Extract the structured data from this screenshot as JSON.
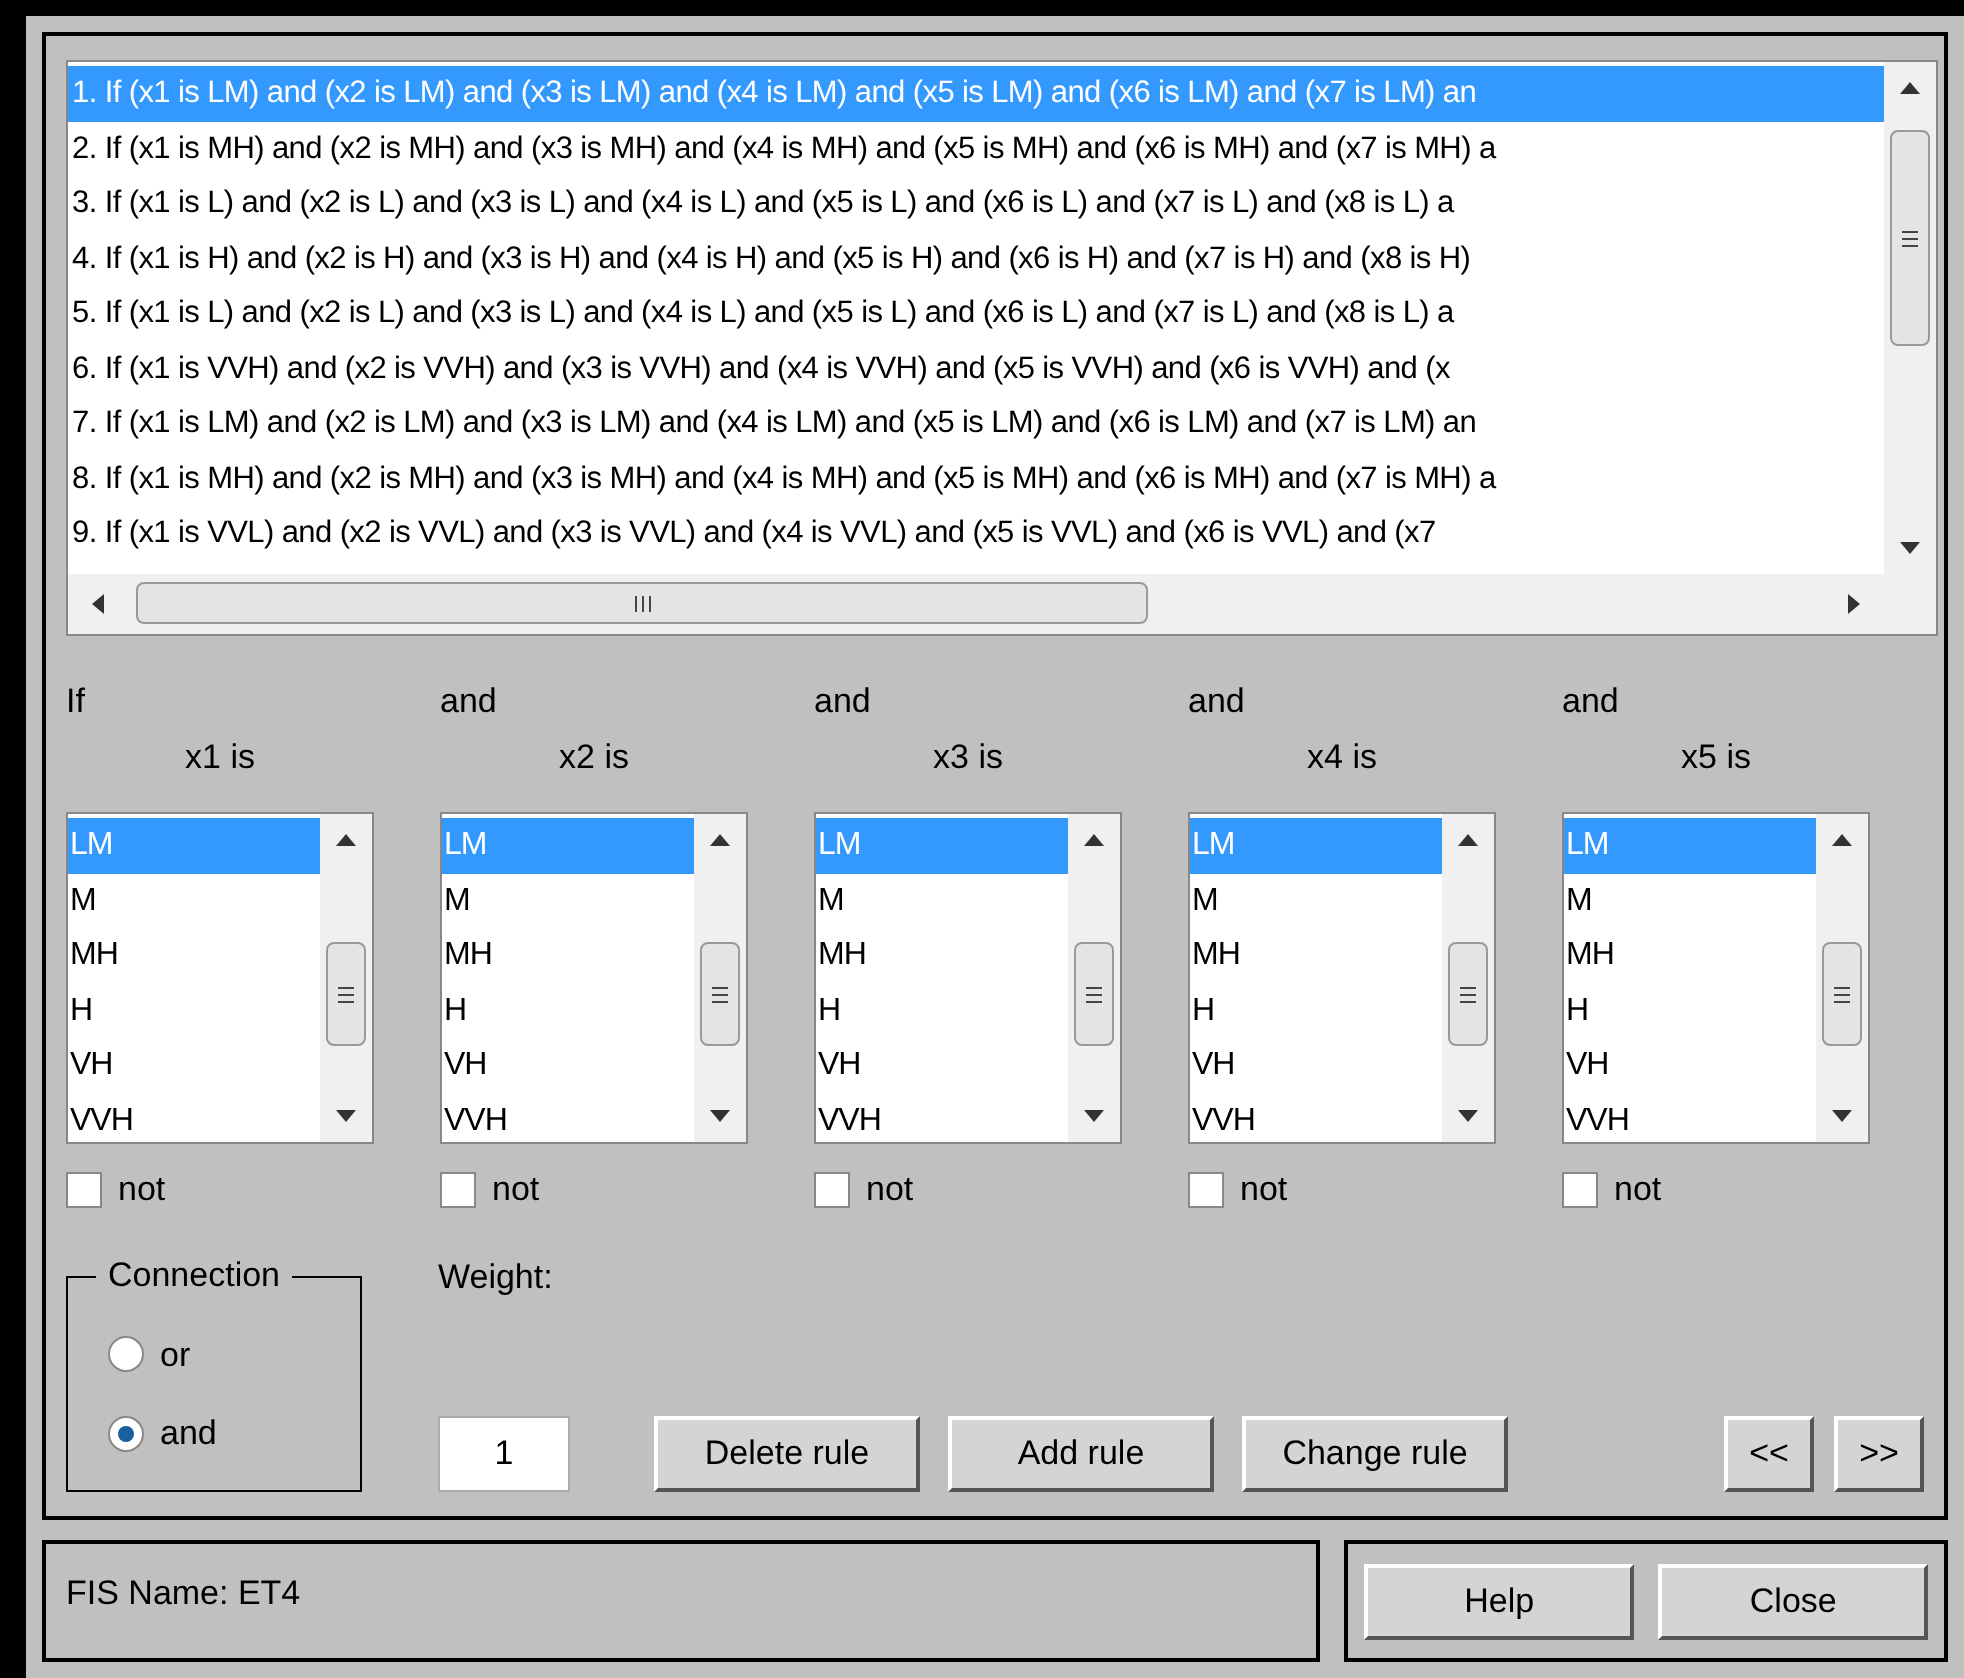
{
  "rules": [
    {
      "text": "1. If (x1 is LM) and (x2 is LM) and (x3 is LM) and (x4 is LM) and (x5 is LM) and (x6 is LM) and (x7 is LM) an",
      "selected": true
    },
    {
      "text": "2. If (x1 is MH) and (x2 is MH) and (x3 is MH) and (x4 is MH) and (x5 is MH) and (x6 is MH) and (x7 is MH) a",
      "selected": false
    },
    {
      "text": "3. If (x1 is L) and (x2 is L) and (x3 is L) and (x4 is L) and (x5 is L) and (x6 is L) and (x7 is L) and (x8 is L) a",
      "selected": false
    },
    {
      "text": "4. If (x1 is H) and (x2 is H) and (x3 is H) and (x4 is H) and (x5 is H) and (x6 is H) and (x7 is H) and (x8 is H)",
      "selected": false
    },
    {
      "text": "5. If (x1 is L) and (x2 is L) and (x3 is L) and (x4 is L) and (x5 is L) and (x6 is L) and (x7 is L) and (x8 is L) a",
      "selected": false
    },
    {
      "text": "6. If (x1 is VVH) and (x2 is VVH) and (x3 is VVH) and (x4 is VVH) and (x5 is VVH) and (x6 is VVH) and (x",
      "selected": false
    },
    {
      "text": "7. If (x1 is LM) and (x2 is LM) and (x3 is LM) and (x4 is LM) and (x5 is LM) and (x6 is LM) and (x7 is LM) an",
      "selected": false
    },
    {
      "text": "8. If (x1 is MH) and (x2 is MH) and (x3 is MH) and (x4 is MH) and (x5 is MH) and (x6 is MH) and (x7 is MH) a",
      "selected": false
    },
    {
      "text": "9. If (x1 is VVL) and (x2 is VVL) and (x3 is VVL) and (x4 is VVL) and (x5 is VVL) and (x6 is VVL) and (x7",
      "selected": false
    }
  ],
  "antecedents": [
    {
      "connector": "If",
      "label": "x1 is",
      "items": [
        {
          "text": "LM",
          "selected": true
        },
        {
          "text": "M",
          "selected": false
        },
        {
          "text": "MH",
          "selected": false
        },
        {
          "text": "H",
          "selected": false
        },
        {
          "text": "VH",
          "selected": false
        },
        {
          "text": "VVH",
          "selected": false
        }
      ],
      "not": {
        "label": "not",
        "checked": false
      }
    },
    {
      "connector": "and",
      "label": "x2 is",
      "items": [
        {
          "text": "LM",
          "selected": true
        },
        {
          "text": "M",
          "selected": false
        },
        {
          "text": "MH",
          "selected": false
        },
        {
          "text": "H",
          "selected": false
        },
        {
          "text": "VH",
          "selected": false
        },
        {
          "text": "VVH",
          "selected": false
        }
      ],
      "not": {
        "label": "not",
        "checked": false
      }
    },
    {
      "connector": "and",
      "label": "x3 is",
      "items": [
        {
          "text": "LM",
          "selected": true
        },
        {
          "text": "M",
          "selected": false
        },
        {
          "text": "MH",
          "selected": false
        },
        {
          "text": "H",
          "selected": false
        },
        {
          "text": "VH",
          "selected": false
        },
        {
          "text": "VVH",
          "selected": false
        }
      ],
      "not": {
        "label": "not",
        "checked": false
      }
    },
    {
      "connector": "and",
      "label": "x4 is",
      "items": [
        {
          "text": "LM",
          "selected": true
        },
        {
          "text": "M",
          "selected": false
        },
        {
          "text": "MH",
          "selected": false
        },
        {
          "text": "H",
          "selected": false
        },
        {
          "text": "VH",
          "selected": false
        },
        {
          "text": "VVH",
          "selected": false
        }
      ],
      "not": {
        "label": "not",
        "checked": false
      }
    },
    {
      "connector": "and",
      "label": "x5 is",
      "items": [
        {
          "text": "LM",
          "selected": true
        },
        {
          "text": "M",
          "selected": false
        },
        {
          "text": "MH",
          "selected": false
        },
        {
          "text": "H",
          "selected": false
        },
        {
          "text": "VH",
          "selected": false
        },
        {
          "text": "VVH",
          "selected": false
        }
      ],
      "not": {
        "label": "not",
        "checked": false
      }
    }
  ],
  "connection": {
    "title": "Connection",
    "options": [
      {
        "label": "or",
        "selected": false
      },
      {
        "label": "and",
        "selected": true
      }
    ]
  },
  "weight": {
    "label": "Weight:",
    "value": "1"
  },
  "rule_buttons": [
    "Delete rule",
    "Add rule",
    "Change rule"
  ],
  "nav_buttons": [
    "<<",
    ">>"
  ],
  "status": "FIS Name: ET4",
  "footer_buttons": [
    "Help",
    "Close"
  ]
}
